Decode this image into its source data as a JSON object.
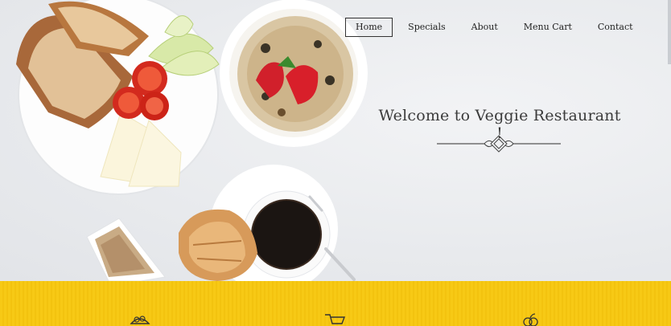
{
  "nav": {
    "items": [
      {
        "label": "Home",
        "active": true
      },
      {
        "label": "Specials",
        "active": false
      },
      {
        "label": "About",
        "active": false
      },
      {
        "label": "Menu Cart",
        "active": false
      },
      {
        "label": "Contact",
        "active": false
      }
    ]
  },
  "hero": {
    "welcome_text": "Welcome to Veggie Restaurant !"
  },
  "colors": {
    "band": "#f7c915",
    "text": "#3b3b3b",
    "background": "#eceff1"
  },
  "icons": [
    "salad-icon",
    "cart-icon",
    "fruit-icon"
  ]
}
